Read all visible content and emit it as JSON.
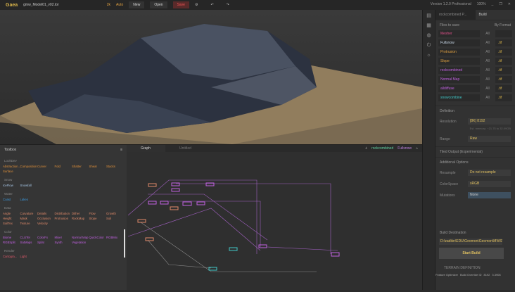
{
  "titlebar": {
    "app": "Gaea",
    "file": "gmw_Model01_v02.tor",
    "resolution": "2k",
    "mode": "Auto",
    "new": "New",
    "open": "Open",
    "save": "Save",
    "version": "Version 1.2.0 Professional",
    "zoom": "100%"
  },
  "right_panel": {
    "tabs": [
      "rockcombined P...",
      "Build"
    ],
    "files_section": "Files to save",
    "by_format": "By Format",
    "files": [
      {
        "name": "Mesher",
        "all": "All",
        "format": "",
        "color": "#e0508a"
      },
      {
        "name": "Fullsnow",
        "all": "All",
        "format": ".tif",
        "color": "#c8d8e8"
      },
      {
        "name": "Protrusion",
        "all": "All",
        "format": ".tif",
        "color": "#e0a040"
      },
      {
        "name": "Slope",
        "all": "All",
        "format": ".tif",
        "color": "#e0a040"
      },
      {
        "name": "rockcombined",
        "all": "All",
        "format": ".tif",
        "color": "#c060e0"
      },
      {
        "name": "Normal Map",
        "all": "All",
        "format": ".tif",
        "color": "#c060e0"
      },
      {
        "name": "alldiffuse",
        "all": "All",
        "format": ".tif",
        "color": "#c060e0"
      },
      {
        "name": "snowcombine",
        "all": "All",
        "format": ".tif",
        "color": "#40c8c8"
      }
    ],
    "definition": "Definition",
    "resolution_label": "Resolution",
    "resolution": "[8K] 8192",
    "memory": "Est. memory: ~21.75 to 32.09GB",
    "range_label": "Range",
    "range": "Raw",
    "tiled": "Tiled Output (Experimental)",
    "additional": "Additional Options",
    "resample_label": "Resample",
    "resample": "Do not resample",
    "colorspace_label": "ColorSpace",
    "colorspace": "sRGB",
    "mutations_label": "Mutations",
    "mutations": "None",
    "dest_label": "Build Destination",
    "dest": "D:\\zadkin\\EDU\\Geomon\\Geomon\\MWS\\",
    "start": "Start Build",
    "terrain": "TERRAIN DEFINITION",
    "status": [
      "Feature Optimizer",
      "Build Override ID",
      "8192",
      "3.3908"
    ]
  },
  "toolbox": {
    "title": "Toolbox",
    "categories": [
      {
        "name": "LookDev",
        "color": "#e0903a",
        "items": [
          "Abstraction...",
          "Composition",
          "Curver",
          "Fold",
          "Shatter",
          "Shear",
          "Stacks",
          "Surface"
        ]
      },
      {
        "name": "Snow",
        "color": "#a8c8e8",
        "items": [
          "IceFlow",
          "Snowfall"
        ]
      },
      {
        "name": "Water",
        "color": "#3a9ae0",
        "items": [
          "Coast",
          "Lakes"
        ]
      },
      {
        "name": "Data",
        "color": "#e08a6a",
        "items": [
          "Angle",
          "Curvature",
          "Details",
          "Distribution",
          "Dither",
          "Flow",
          "Growth",
          "Height",
          "Mask",
          "Occlusion",
          "Protrusion",
          "RockMap",
          "Slope",
          "Soil",
          "SoilTex",
          "Texture",
          "Velocity"
        ]
      },
      {
        "name": "Color",
        "color": "#c060e0",
        "items": [
          "Biome",
          "CLUTer",
          "ColorFx",
          "Mixer",
          "Normal Map",
          "QuickColor",
          "RGBMix",
          "RGBSplit",
          "SatMaps",
          "Splat",
          "Synth",
          "Vegetation"
        ]
      },
      {
        "name": "Render",
        "color": "#e05a6a",
        "items": [
          "Cartogra...",
          "Light"
        ]
      }
    ]
  },
  "graph": {
    "tabs": [
      "Graph",
      "Untitled"
    ],
    "breadcrumb": [
      "rockcombined",
      "Fullsnow"
    ]
  }
}
